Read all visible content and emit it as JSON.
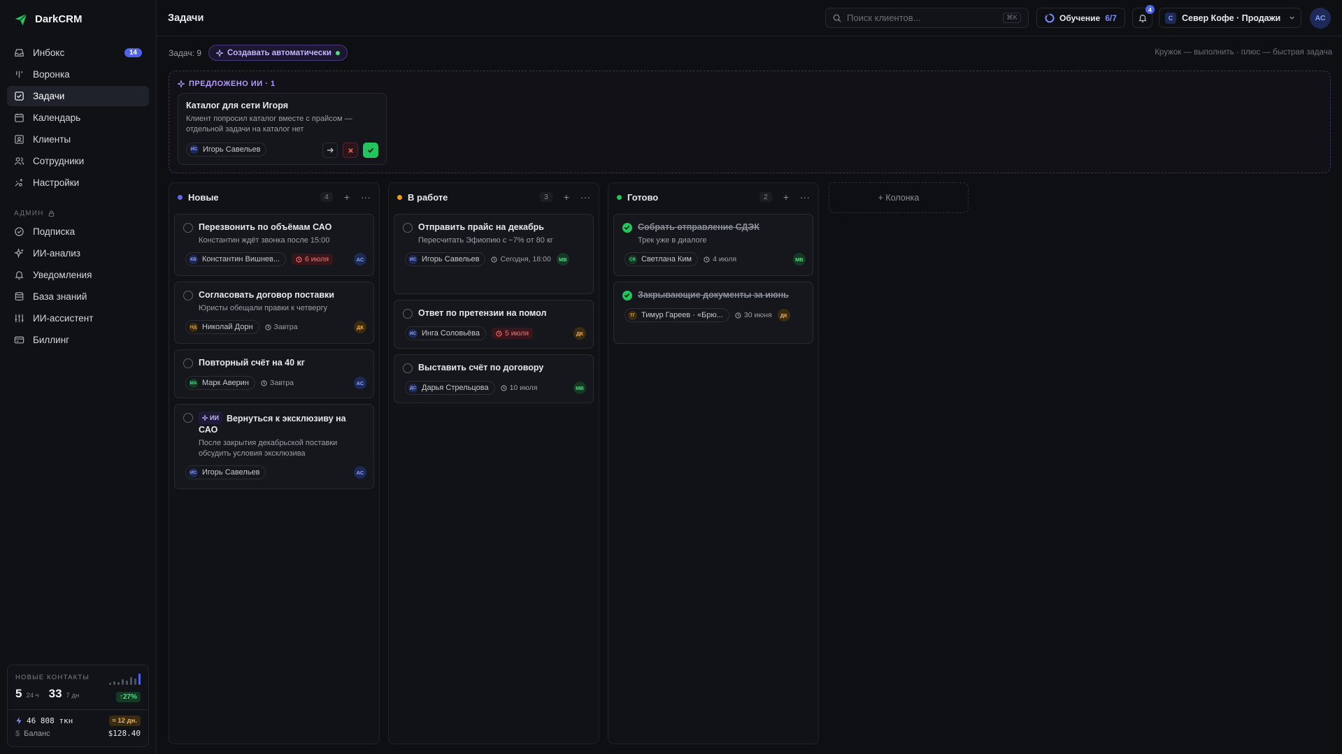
{
  "app": {
    "name": "DarkCRM"
  },
  "sidebar": {
    "items": [
      {
        "label": "Инбокс",
        "icon": "inbox-icon",
        "badge": "14"
      },
      {
        "label": "Воронка",
        "icon": "funnel-icon"
      },
      {
        "label": "Задачи",
        "icon": "tasks-icon",
        "active": true
      },
      {
        "label": "Календарь",
        "icon": "calendar-icon"
      },
      {
        "label": "Клиенты",
        "icon": "clients-icon"
      },
      {
        "label": "Сотрудники",
        "icon": "employees-icon"
      },
      {
        "label": "Настройки",
        "icon": "settings-icon"
      }
    ],
    "admin_label": "АДМИН",
    "admin_items": [
      {
        "label": "Подписка",
        "icon": "subscription-icon"
      },
      {
        "label": "ИИ-анализ",
        "icon": "sparkle-icon"
      },
      {
        "label": "Уведомления",
        "icon": "bell-icon"
      },
      {
        "label": "База знаний",
        "icon": "database-icon"
      },
      {
        "label": "ИИ-ассистент",
        "icon": "sliders-icon"
      },
      {
        "label": "Биллинг",
        "icon": "billing-icon"
      }
    ],
    "stats": {
      "title": "НОВЫЕ КОНТАКТЫ",
      "v24": "5",
      "l24": "24 ч",
      "v7": "33",
      "l7": "7 дн",
      "pct": "↑27%",
      "tokens": "46 808 ткн",
      "days": "≈ 12 дн.",
      "balance_label": "Баланс",
      "balance": "$128.40"
    }
  },
  "header": {
    "title": "Задачи",
    "search_placeholder": "Поиск клиентов...",
    "search_kbd": "⌘K",
    "learn_label": "Обучение",
    "learn_progress": "6/7",
    "notif_count": "4",
    "workspace_initial": "С",
    "workspace": "Север Кофе · Продажи",
    "user_initials": "АС"
  },
  "toolbar": {
    "count": "Задач: 9",
    "auto_label": "Создавать автоматически",
    "hint": "Кружок — выполнить · плюс — быстрая задача"
  },
  "ai": {
    "heading": "ПРЕДЛОЖЕНО ИИ · 1",
    "card": {
      "title": "Каталог для сети Игоря",
      "desc": "Клиент попросил каталог вместе с прайсом — отдельной задачи на каталог нет",
      "contact_initials": "ИС",
      "contact": "Игорь Савельев"
    }
  },
  "columns": [
    {
      "title": "Новые",
      "count": "4",
      "color": "#6366f1"
    },
    {
      "title": "В работе",
      "count": "3",
      "color": "#f59e0b"
    },
    {
      "title": "Готово",
      "count": "2",
      "color": "#22c55e"
    }
  ],
  "cards": {
    "c1": {
      "title": "Перезвонить по объёмам САО",
      "desc": "Константин ждёт звонка после 15:00",
      "ci": "КВ",
      "contact": "Константин Вишнев...",
      "due": "6 июля",
      "asg": "АС"
    },
    "c2": {
      "title": "Согласовать договор поставки",
      "desc": "Юристы обещали правки к четвергу",
      "ci": "НД",
      "contact": "Николай Дорн",
      "due": "Завтра",
      "asg": "ДК"
    },
    "c3": {
      "title": "Повторный счёт на 40 кг",
      "ci": "МА",
      "contact": "Марк Аверин",
      "due": "Завтра",
      "asg": "АС"
    },
    "c4": {
      "tag": "ИИ",
      "title": "Вернуться к эксклюзиву на САО",
      "desc": "После закрытия декабрьской поставки обсудить условия эксклюзива",
      "ci": "ИС",
      "contact": "Игорь Савельев",
      "asg": "АС"
    },
    "w1": {
      "title": "Отправить прайс на декабрь",
      "desc": "Пересчитать Эфиопию с −7% от 80 кг",
      "ci": "ИС",
      "contact": "Игорь Савельев",
      "due": "Сегодня, 18:00",
      "asg": "МВ"
    },
    "w2": {
      "title": "Ответ по претензии на помол",
      "ci": "ИС",
      "contact": "Инга Соловьёва",
      "due": "5 июля",
      "asg": "ДК"
    },
    "w3": {
      "title": "Выставить счёт по договору",
      "ci": "ДС",
      "contact": "Дарья Стрельцова",
      "due": "10 июля",
      "asg": "МВ"
    },
    "d1": {
      "title": "Собрать отправление СДЭК",
      "desc": "Трек уже в диалоге",
      "ci": "СК",
      "contact": "Светлана Ким",
      "due": "4 июля",
      "asg": "МВ"
    },
    "d2": {
      "title": "Закрывающие документы за июнь",
      "ci": "ТГ",
      "contact": "Тимур Гареев · «Брю...",
      "due": "30 июня",
      "asg": "ДК"
    }
  },
  "add_column": "+ Колонка",
  "colors": {
    "accent": "#4f63e6",
    "ai": "#b49cfa",
    "success": "#22c55e",
    "danger": "#f87171",
    "warning": "#f5b041"
  }
}
